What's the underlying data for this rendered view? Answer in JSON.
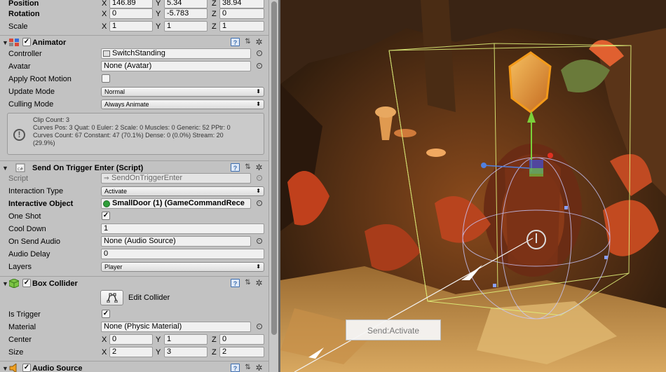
{
  "transform": {
    "position": {
      "label": "Position",
      "x": "146.89",
      "y": "5.34",
      "z": "38.94"
    },
    "rotation": {
      "label": "Rotation",
      "x": "0",
      "y": "-5.783",
      "z": "0"
    },
    "scale": {
      "label": "Scale",
      "x": "1",
      "y": "1",
      "z": "1"
    }
  },
  "axis": {
    "x": "X",
    "y": "Y",
    "z": "Z"
  },
  "animator": {
    "title": "Animator",
    "controller": {
      "label": "Controller",
      "value": "SwitchStanding"
    },
    "avatar": {
      "label": "Avatar",
      "value": "None (Avatar)"
    },
    "apply_root_motion": {
      "label": "Apply Root Motion",
      "checked": false
    },
    "update_mode": {
      "label": "Update Mode",
      "value": "Normal"
    },
    "culling_mode": {
      "label": "Culling Mode",
      "value": "Always Animate"
    },
    "info": {
      "line1": "Clip Count: 3",
      "line2": "Curves Pos: 3 Quat: 0 Euler: 2 Scale: 0 Muscles: 0 Generic: 52 PPtr: 0",
      "line3": "Curves Count: 67 Constant: 47 (70.1%) Dense: 0 (0.0%) Stream: 20",
      "line4": "(29.9%)"
    }
  },
  "send_on_trigger": {
    "title": "Send On Trigger Enter (Script)",
    "script": {
      "label": "Script",
      "value": "SendOnTriggerEnter"
    },
    "interaction_type": {
      "label": "Interaction Type",
      "value": "Activate"
    },
    "interactive_object": {
      "label": "Interactive Object",
      "value": "SmallDoor (1) (GameCommandRece"
    },
    "one_shot": {
      "label": "One Shot",
      "checked": true
    },
    "cool_down": {
      "label": "Cool Down",
      "value": "1"
    },
    "on_send_audio": {
      "label": "On Send Audio",
      "value": "None (Audio Source)"
    },
    "audio_delay": {
      "label": "Audio Delay",
      "value": "0"
    },
    "layers": {
      "label": "Layers",
      "value": "Player"
    }
  },
  "box_collider": {
    "title": "Box Collider",
    "edit_collider": "Edit Collider",
    "is_trigger": {
      "label": "Is Trigger",
      "checked": true
    },
    "material": {
      "label": "Material",
      "value": "None (Physic Material)"
    },
    "center": {
      "label": "Center",
      "x": "0",
      "y": "1",
      "z": "0"
    },
    "size": {
      "label": "Size",
      "x": "2",
      "y": "3",
      "z": "2"
    }
  },
  "audio_source": {
    "title": "Audio Source"
  },
  "scene": {
    "send_button": "Send:Activate"
  },
  "colors": {
    "scene_bg": "#2b1d10",
    "selection_orange": "#f39a1a",
    "gizmo_lime": "#dff07a"
  }
}
